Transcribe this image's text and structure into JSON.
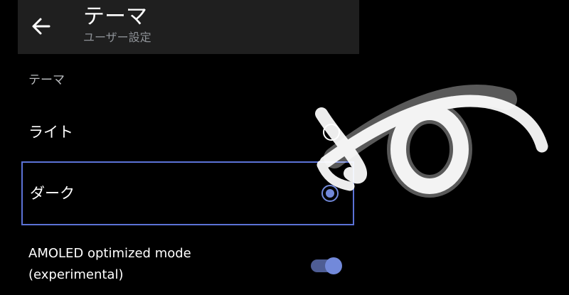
{
  "header": {
    "title": "テーマ",
    "subtitle": "ユーザー設定",
    "back_icon": "arrow-left-icon"
  },
  "theme_section": {
    "label": "テーマ",
    "options": [
      {
        "label": "ライト",
        "selected": false
      },
      {
        "label": "ダーク",
        "selected": true
      }
    ]
  },
  "amoled": {
    "line1": "AMOLED optimized mode",
    "line2": "(experimental)",
    "enabled": true
  },
  "colors": {
    "accent": "#7289da",
    "selection_border": "#5b72d6",
    "background": "#000000",
    "header_bg": "#1f1f1f"
  },
  "annotation": {
    "icon": "hand-drawn-arrow-annotation",
    "color": "#ffffff"
  }
}
